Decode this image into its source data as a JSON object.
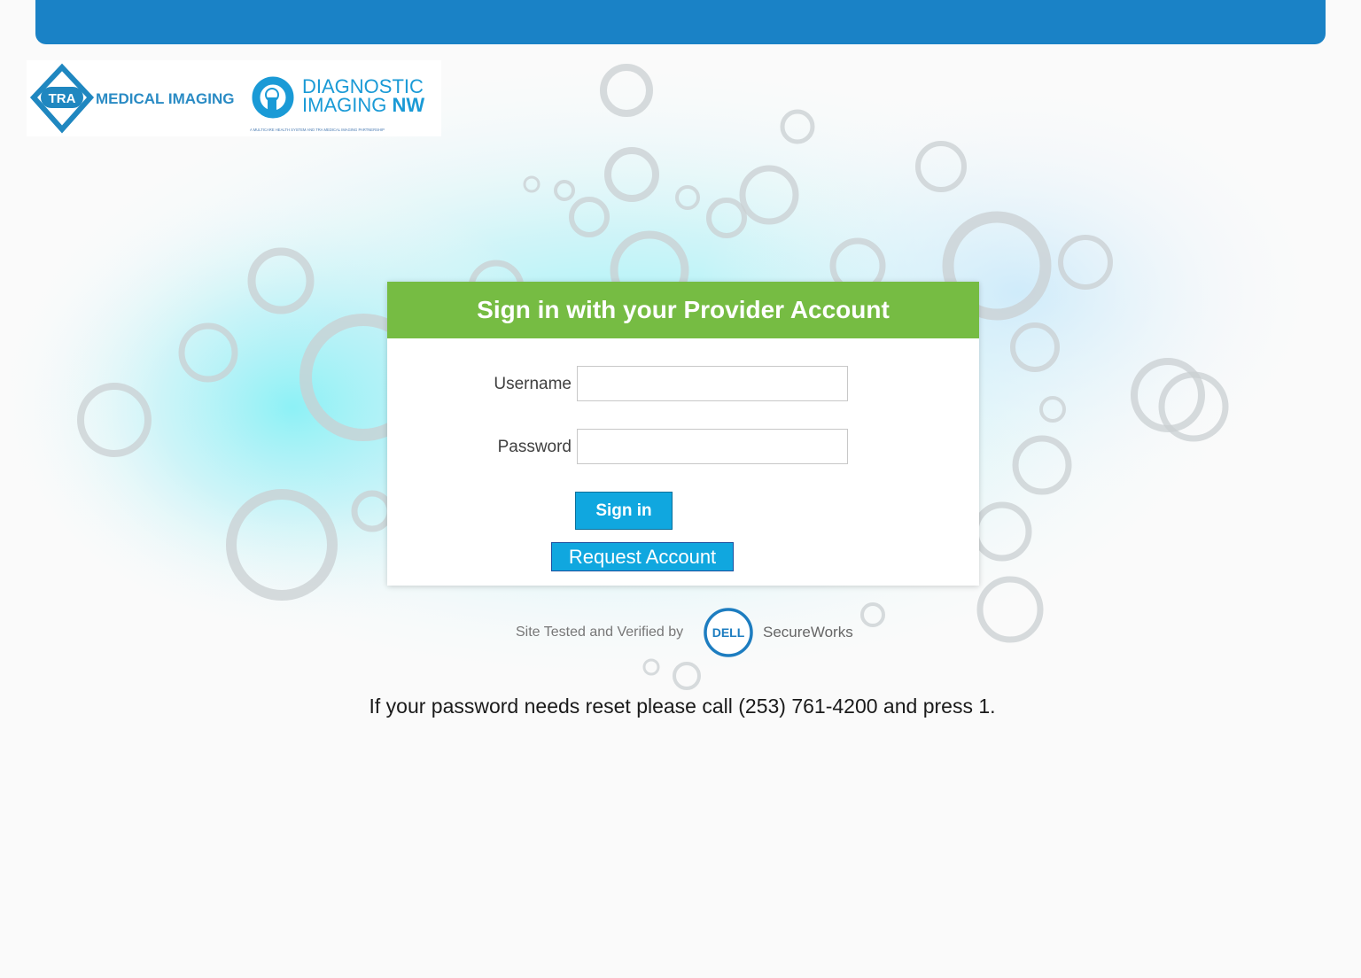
{
  "brand": {
    "tra_mark": "TRA",
    "tra_name": "MEDICAL IMAGING",
    "dinw_line1": "DIAGNOSTIC",
    "dinw_line2_a": "IMAGING ",
    "dinw_line2_b": "NW",
    "dinw_tagline": "A MULTICARE HEALTH SYSTEM AND TRA MEDICAL IMAGING PARTNERSHIP"
  },
  "login": {
    "title": "Sign in with your Provider Account",
    "username_label": "Username",
    "username_value": "",
    "password_label": "Password",
    "password_value": "",
    "signin_label": "Sign in",
    "request_label": "Request Account"
  },
  "verified": {
    "text": "Site Tested and Verified by",
    "dell": "DELL",
    "secureworks": "SecureWorks"
  },
  "reset_note": "If your password needs reset please call (253) 761-4200 and press 1.",
  "colors": {
    "top_bar": "#1a82c6",
    "header_green": "#76bc43",
    "button_blue": "#10a7df",
    "dell_blue": "#1d7dc0"
  }
}
